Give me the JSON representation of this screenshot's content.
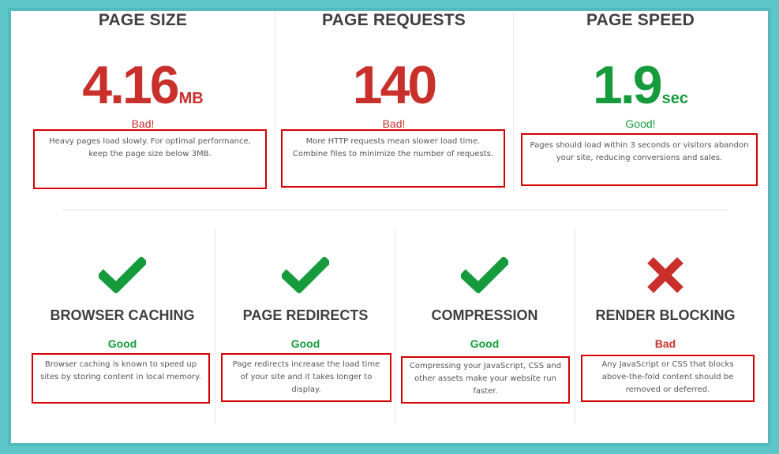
{
  "colors": {
    "frame": "#5cc6c8",
    "bad": "#c9302c",
    "good": "#159b3c",
    "highlight_box": "#d40000",
    "title": "#3f3f3f"
  },
  "top": {
    "page_size": {
      "title": "PAGE SIZE",
      "value": "4.16",
      "unit": "MB",
      "status": "Bad!",
      "description": "Heavy pages load slowly. For optimal performance, keep the page size below 3MB."
    },
    "page_requests": {
      "title": "PAGE REQUESTS",
      "value": "140",
      "unit": "",
      "status": "Bad!",
      "description": "More HTTP requests mean slower load time. Combine files to minimize the number of requests."
    },
    "page_speed": {
      "title": "PAGE SPEED",
      "value": "1.9",
      "unit": "sec",
      "status": "Good!",
      "description": "Pages should load within 3 seconds or visitors abandon your site, reducing conversions and sales."
    }
  },
  "bottom": {
    "browser_caching": {
      "icon": "check-icon",
      "title": "BROWSER CACHING",
      "status": "Good",
      "description": "Browser caching is known to speed up sites by storing content in local memory."
    },
    "page_redirects": {
      "icon": "check-icon",
      "title": "PAGE REDIRECTS",
      "status": "Good",
      "description": "Page redirects increase the load time of your site and it takes longer to display."
    },
    "compression": {
      "icon": "check-icon",
      "title": "COMPRESSION",
      "status": "Good",
      "description": "Compressing your JavaScript, CSS and other assets make your website run faster."
    },
    "render_blocking": {
      "icon": "x-icon",
      "title": "RENDER BLOCKING",
      "status": "Bad",
      "description": "Any JavaScript or CSS that blocks above-the-fold content should be removed or deferred."
    }
  }
}
